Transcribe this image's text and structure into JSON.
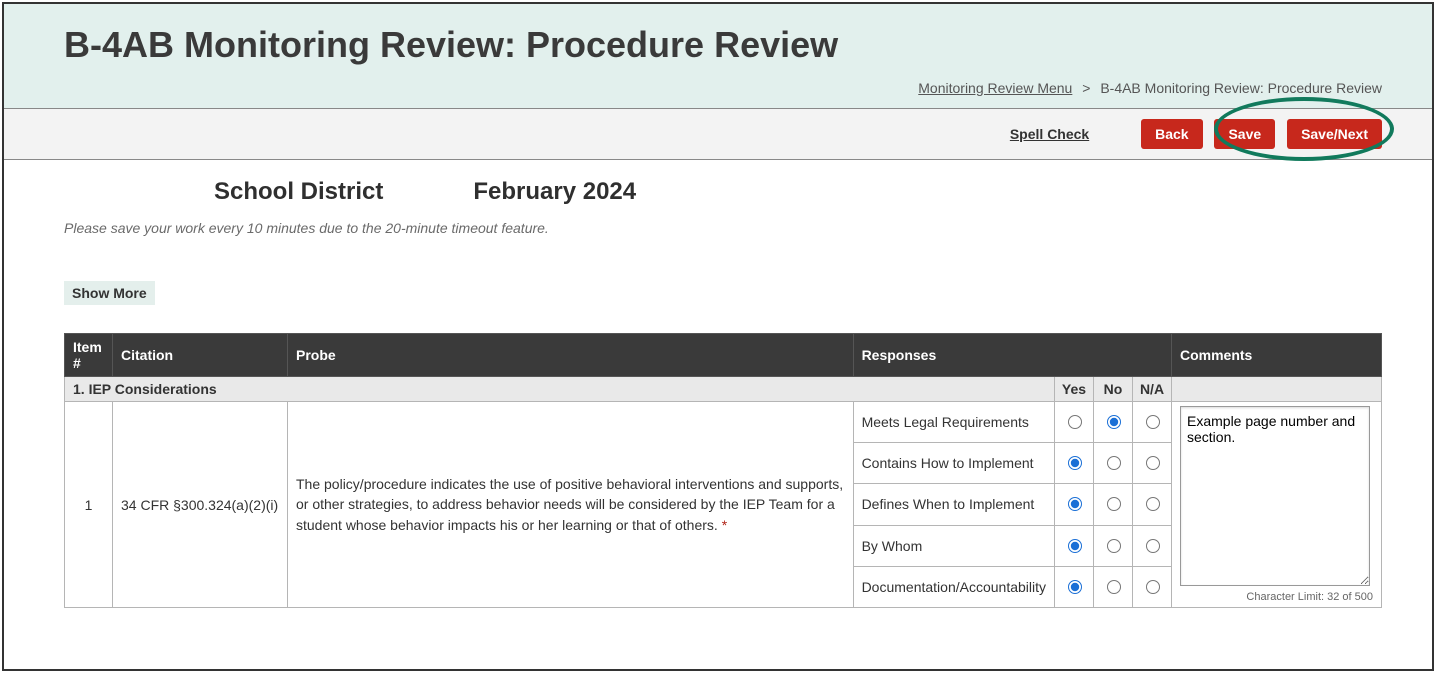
{
  "header": {
    "title": "B-4AB Monitoring Review: Procedure Review",
    "breadcrumb": {
      "link": "Monitoring Review Menu",
      "separator": ">",
      "current": "B-4AB Monitoring Review: Procedure Review"
    }
  },
  "toolbar": {
    "spell_check": "Spell Check",
    "back": "Back",
    "save": "Save",
    "save_next": "Save/Next"
  },
  "subhead": {
    "school_district": "School District",
    "date": "February 2024"
  },
  "note": "Please save your work every 10 minutes due to the 20-minute timeout feature.",
  "show_more": "Show More",
  "table": {
    "headers": {
      "item": "Item #",
      "citation": "Citation",
      "probe": "Probe",
      "responses": "Responses",
      "comments": "Comments",
      "yes": "Yes",
      "no": "No",
      "na": "N/A"
    },
    "section": "1. IEP Considerations",
    "row": {
      "item_num": "1",
      "citation": "34 CFR §300.324(a)(2)(i)",
      "probe": "The policy/procedure indicates the use of positive behavioral interventions and supports, or other strategies, to address behavior needs will be considered by the IEP Team for a student whose behavior impacts his or her learning or that of others. ",
      "asterisk": "*",
      "responses": [
        {
          "label": "Meets Legal Requirements",
          "selected": "no"
        },
        {
          "label": "Contains How to Implement",
          "selected": "yes"
        },
        {
          "label": "Defines When to Implement",
          "selected": "yes"
        },
        {
          "label": "By Whom",
          "selected": "yes"
        },
        {
          "label": "Documentation/Accountability",
          "selected": "yes"
        }
      ],
      "comment_value": "Example page number and section.",
      "char_limit": "Character Limit: 32 of 500"
    }
  }
}
